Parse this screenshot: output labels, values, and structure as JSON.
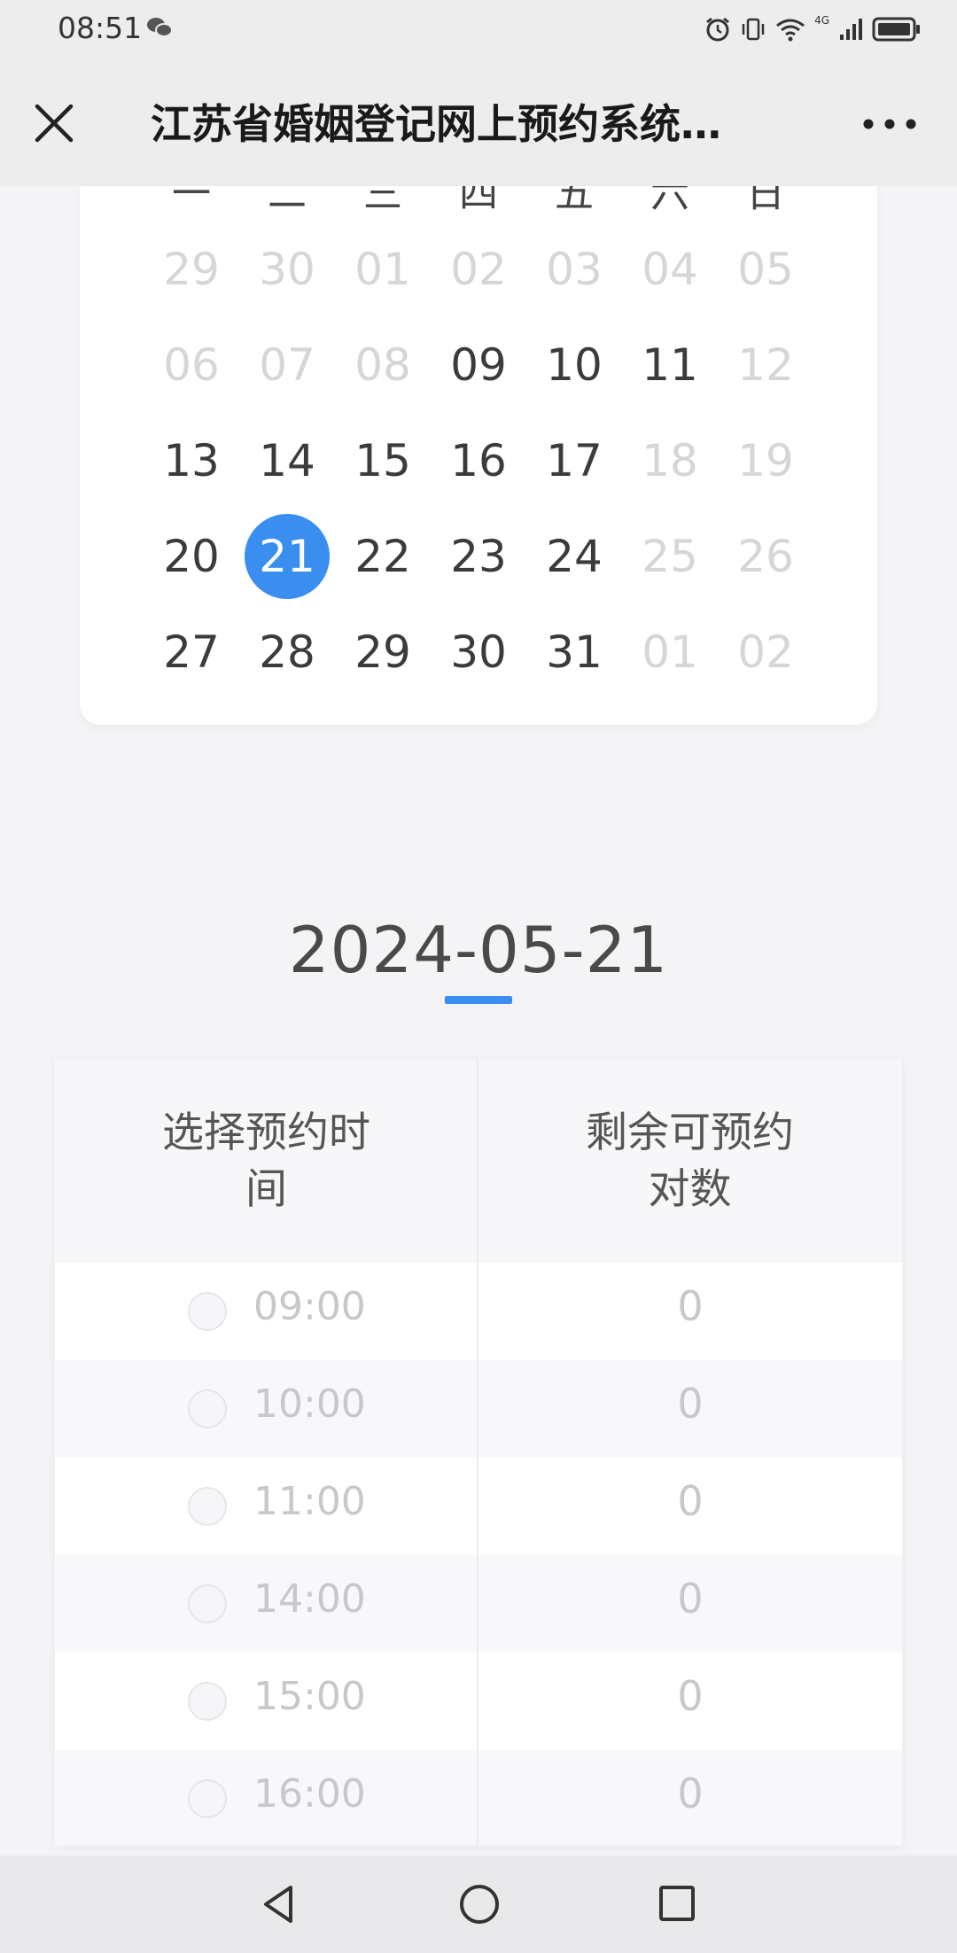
{
  "status_bar": {
    "time": "08:51",
    "network": "4G",
    "icons": [
      "wechat-icon",
      "alarm-icon",
      "vibrate-icon",
      "wifi-icon",
      "signal-icon",
      "battery-icon"
    ]
  },
  "title_bar": {
    "title": "江苏省婚姻登记网上预约系统…",
    "close_icon": "close-icon",
    "more_icon": "more-icon"
  },
  "calendar": {
    "weekdays": [
      "一",
      "二",
      "三",
      "四",
      "五",
      "六",
      "日"
    ],
    "weeks": [
      [
        {
          "d": "29",
          "state": "disabled"
        },
        {
          "d": "30",
          "state": "disabled"
        },
        {
          "d": "01",
          "state": "disabled"
        },
        {
          "d": "02",
          "state": "disabled"
        },
        {
          "d": "03",
          "state": "disabled"
        },
        {
          "d": "04",
          "state": "disabled"
        },
        {
          "d": "05",
          "state": "disabled"
        }
      ],
      [
        {
          "d": "06",
          "state": "disabled"
        },
        {
          "d": "07",
          "state": "disabled"
        },
        {
          "d": "08",
          "state": "disabled"
        },
        {
          "d": "09",
          "state": "enabled"
        },
        {
          "d": "10",
          "state": "enabled"
        },
        {
          "d": "11",
          "state": "enabled"
        },
        {
          "d": "12",
          "state": "disabled"
        }
      ],
      [
        {
          "d": "13",
          "state": "enabled"
        },
        {
          "d": "14",
          "state": "enabled"
        },
        {
          "d": "15",
          "state": "enabled"
        },
        {
          "d": "16",
          "state": "enabled"
        },
        {
          "d": "17",
          "state": "enabled"
        },
        {
          "d": "18",
          "state": "disabled"
        },
        {
          "d": "19",
          "state": "disabled"
        }
      ],
      [
        {
          "d": "20",
          "state": "enabled"
        },
        {
          "d": "21",
          "state": "selected"
        },
        {
          "d": "22",
          "state": "enabled"
        },
        {
          "d": "23",
          "state": "enabled"
        },
        {
          "d": "24",
          "state": "enabled"
        },
        {
          "d": "25",
          "state": "disabled"
        },
        {
          "d": "26",
          "state": "disabled"
        }
      ],
      [
        {
          "d": "27",
          "state": "enabled"
        },
        {
          "d": "28",
          "state": "enabled"
        },
        {
          "d": "29",
          "state": "enabled"
        },
        {
          "d": "30",
          "state": "enabled"
        },
        {
          "d": "31",
          "state": "enabled"
        },
        {
          "d": "01",
          "state": "disabled"
        },
        {
          "d": "02",
          "state": "disabled"
        }
      ]
    ],
    "selected_color": "#3a8ef0"
  },
  "selected_date": "2024-05-21",
  "slot_table": {
    "header_time": "选择预约时\n间",
    "header_count": "剩余可预约\n对数",
    "rows": [
      {
        "time": "09:00",
        "count": "0"
      },
      {
        "time": "10:00",
        "count": "0"
      },
      {
        "time": "11:00",
        "count": "0"
      },
      {
        "time": "14:00",
        "count": "0"
      },
      {
        "time": "15:00",
        "count": "0"
      },
      {
        "time": "16:00",
        "count": "0"
      }
    ]
  },
  "nav_bar": {
    "back_icon": "back-triangle-icon",
    "home_icon": "home-circle-icon",
    "recent_icon": "recent-square-icon"
  }
}
